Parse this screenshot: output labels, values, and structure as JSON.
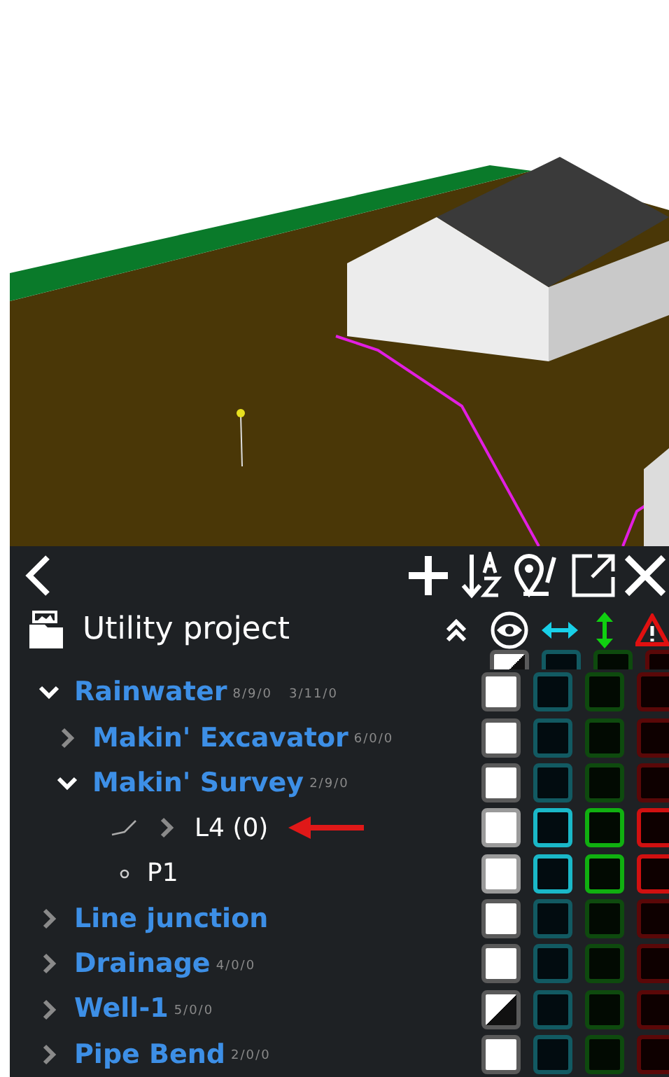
{
  "toolbar": {
    "title": "Utility project"
  },
  "partial_row": {
    "mixed": true
  },
  "layers": [
    {
      "kind": "group",
      "name": "Rainwater",
      "counts": [
        "8/9/0",
        "3/11/0"
      ],
      "expanded": true,
      "mixed": false,
      "horizontal": false,
      "vertical": false,
      "warning": false,
      "active": false,
      "children": [
        {
          "kind": "group",
          "name": "Makin' Excavator",
          "counts": [
            "6/0/0"
          ],
          "expanded": false,
          "mixed": false,
          "horizontal": false,
          "vertical": false,
          "warning": false,
          "active": false
        },
        {
          "kind": "group",
          "name": "Makin' Survey",
          "counts": [
            "2/9/0"
          ],
          "expanded": true,
          "mixed": false,
          "horizontal": false,
          "vertical": false,
          "warning": false,
          "active": false,
          "children": [
            {
              "kind": "line",
              "name": "L4 (0)",
              "expanded": false,
              "mixed": false,
              "horizontal": false,
              "vertical": false,
              "warning": false,
              "active": true,
              "pointer": true
            },
            {
              "kind": "point",
              "name": "P1",
              "mixed": false,
              "horizontal": false,
              "vertical": false,
              "warning": false,
              "active": true
            }
          ]
        }
      ]
    },
    {
      "kind": "group",
      "name": "Line junction",
      "expanded": false,
      "mixed": false,
      "horizontal": false,
      "vertical": false,
      "warning": false,
      "active": false
    },
    {
      "kind": "group",
      "name": "Drainage",
      "counts": [
        "4/0/0"
      ],
      "expanded": false,
      "mixed": false,
      "horizontal": false,
      "vertical": false,
      "warning": false,
      "active": false
    },
    {
      "kind": "group",
      "name": "Well-1",
      "counts": [
        "5/0/0"
      ],
      "expanded": false,
      "mixed": true,
      "horizontal": false,
      "vertical": false,
      "warning": false,
      "active": false
    },
    {
      "kind": "group",
      "name": "Pipe Bend",
      "counts": [
        "2/0/0"
      ],
      "expanded": false,
      "mixed": false,
      "horizontal": false,
      "vertical": false,
      "warning": false,
      "active": false
    }
  ]
}
